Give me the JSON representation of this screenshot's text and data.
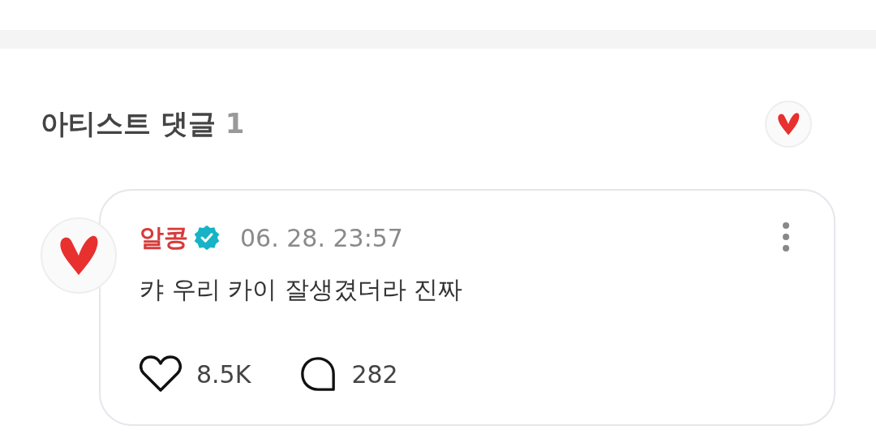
{
  "section": {
    "title": "아티스트 댓글",
    "count": "1"
  },
  "comment": {
    "author": "알콩",
    "verified": true,
    "time": "06. 28. 23:57",
    "text": "캬 우리 카이 잘생겼더라 진짜",
    "likes": "8.5K",
    "replies": "282"
  }
}
